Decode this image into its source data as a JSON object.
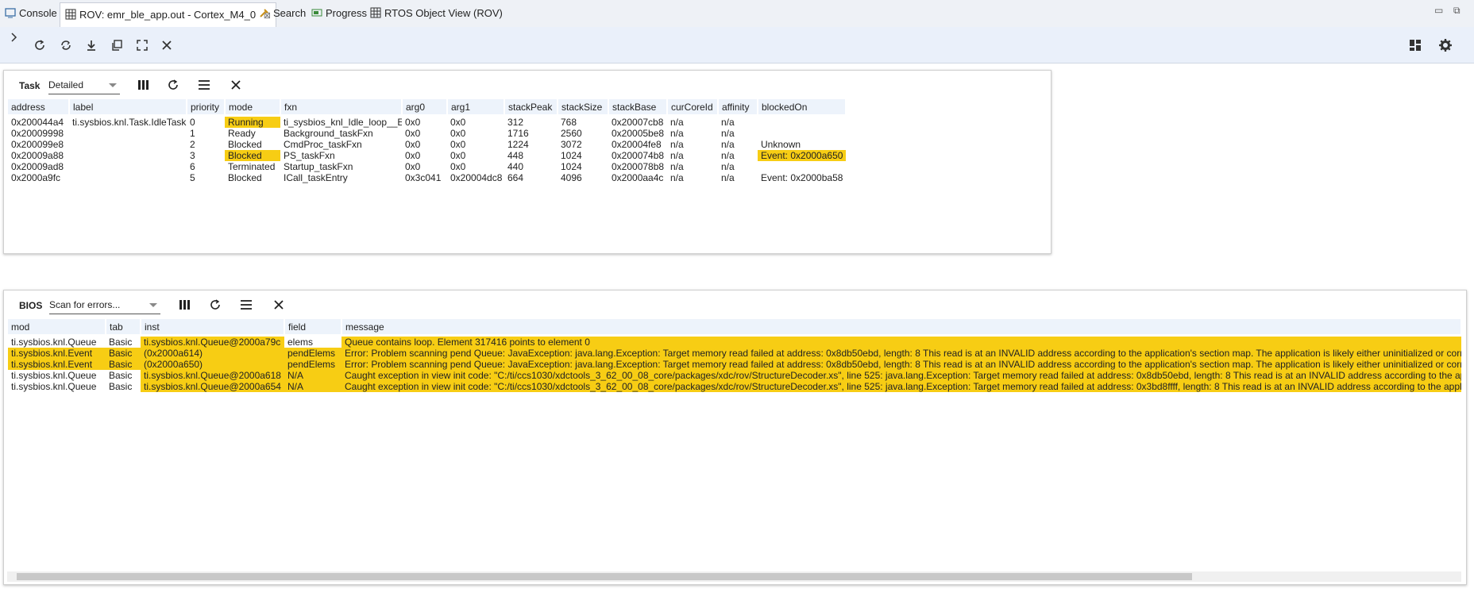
{
  "tabs": [
    {
      "label": "Console",
      "icon": "console-icon"
    },
    {
      "label": "ROV: emr_ble_app.out - Cortex_M4_0",
      "icon": "table-icon",
      "active": true
    },
    {
      "label": "Search",
      "icon": "search-icon"
    },
    {
      "label": "Progress",
      "icon": "progress-icon"
    },
    {
      "label": "RTOS Object View (ROV)",
      "icon": "table-icon"
    }
  ],
  "colors": {
    "highlight": "#f7cd14",
    "toolbar": "#eaf0fa",
    "header": "#edf3fb"
  },
  "task_panel": {
    "title": "Task",
    "view_select": "Detailed",
    "columns": [
      "address",
      "label",
      "priority",
      "mode",
      "fxn",
      "arg0",
      "arg1",
      "stackPeak",
      "stackSize",
      "stackBase",
      "curCoreId",
      "affinity",
      "blockedOn"
    ],
    "rows": [
      {
        "address": "0x200044a4",
        "label": "ti.sysbios.knl.Task.IdleTask",
        "priority": "0",
        "mode": "Running",
        "fxn": "ti_sysbios_knl_Idle_loop__E",
        "arg0": "0x0",
        "arg1": "0x0",
        "stackPeak": "312",
        "stackSize": "768",
        "stackBase": "0x20007cb8",
        "curCoreId": "n/a",
        "affinity": "n/a",
        "blockedOn": ""
      },
      {
        "address": "0x20009998",
        "label": "",
        "priority": "1",
        "mode": "Ready",
        "fxn": "Background_taskFxn",
        "arg0": "0x0",
        "arg1": "0x0",
        "stackPeak": "1716",
        "stackSize": "2560",
        "stackBase": "0x20005be8",
        "curCoreId": "n/a",
        "affinity": "n/a",
        "blockedOn": ""
      },
      {
        "address": "0x200099e8",
        "label": "",
        "priority": "2",
        "mode": "Blocked",
        "fxn": "CmdProc_taskFxn",
        "arg0": "0x0",
        "arg1": "0x0",
        "stackPeak": "1224",
        "stackSize": "3072",
        "stackBase": "0x20004fe8",
        "curCoreId": "n/a",
        "affinity": "n/a",
        "blockedOn": "Unknown"
      },
      {
        "address": "0x20009a88",
        "label": "",
        "priority": "3",
        "mode": "Blocked",
        "fxn": "PS_taskFxn",
        "arg0": "0x0",
        "arg1": "0x0",
        "stackPeak": "448",
        "stackSize": "1024",
        "stackBase": "0x200074b8",
        "curCoreId": "n/a",
        "affinity": "n/a",
        "blockedOn": "Event: 0x2000a650"
      },
      {
        "address": "0x20009ad8",
        "label": "",
        "priority": "6",
        "mode": "Terminated",
        "fxn": "Startup_taskFxn",
        "arg0": "0x0",
        "arg1": "0x0",
        "stackPeak": "440",
        "stackSize": "1024",
        "stackBase": "0x200078b8",
        "curCoreId": "n/a",
        "affinity": "n/a",
        "blockedOn": ""
      },
      {
        "address": "0x2000a9fc",
        "label": "",
        "priority": "5",
        "mode": "Blocked",
        "fxn": "ICall_taskEntry",
        "arg0": "0x3c041",
        "arg1": "0x20004dc8",
        "stackPeak": "664",
        "stackSize": "4096",
        "stackBase": "0x2000aa4c",
        "curCoreId": "n/a",
        "affinity": "n/a",
        "blockedOn": "Event: 0x2000ba58"
      }
    ]
  },
  "bios_panel": {
    "title": "BIOS",
    "view_select": "Scan for errors...",
    "columns": [
      "mod",
      "tab",
      "inst",
      "field",
      "message"
    ],
    "rows": [
      {
        "mod": "ti.sysbios.knl.Queue",
        "tab": "Basic",
        "inst": "ti.sysbios.knl.Queue@2000a79c",
        "field": "elems",
        "message": "Queue contains loop. Element 317416 points to element 0"
      },
      {
        "mod": "ti.sysbios.knl.Event",
        "tab": "Basic",
        "inst": "(0x2000a614)",
        "field": "pendElems",
        "message": "Error: Problem scanning pend Queue: JavaException: java.lang.Exception: Target memory read failed at address: 0x8db50ebd, length: 8 This read is at an INVALID address according to the application's section map. The application is likely either uninitialized or corrup"
      },
      {
        "mod": "ti.sysbios.knl.Event",
        "tab": "Basic",
        "inst": "(0x2000a650)",
        "field": "pendElems",
        "message": "Error: Problem scanning pend Queue: JavaException: java.lang.Exception: Target memory read failed at address: 0x8db50ebd, length: 8 This read is at an INVALID address according to the application's section map. The application is likely either uninitialized or corrup"
      },
      {
        "mod": "ti.sysbios.knl.Queue",
        "tab": "Basic",
        "inst": "ti.sysbios.knl.Queue@2000a618",
        "field": "N/A",
        "message": "Caught exception in view init code: \"C:/ti/ccs1030/xdctools_3_62_00_08_core/packages/xdc/rov/StructureDecoder.xs\", line 525: java.lang.Exception: Target memory read failed at address: 0x8db50ebd, length: 8 This read is at an INVALID address according to the appli"
      },
      {
        "mod": "ti.sysbios.knl.Queue",
        "tab": "Basic",
        "inst": "ti.sysbios.knl.Queue@2000a654",
        "field": "N/A",
        "message": "Caught exception in view init code: \"C:/ti/ccs1030/xdctools_3_62_00_08_core/packages/xdc/rov/StructureDecoder.xs\", line 525: java.lang.Exception: Target memory read failed at address: 0x3bd8ffff, length: 8 This read is at an INVALID address according to the applica"
      }
    ]
  }
}
